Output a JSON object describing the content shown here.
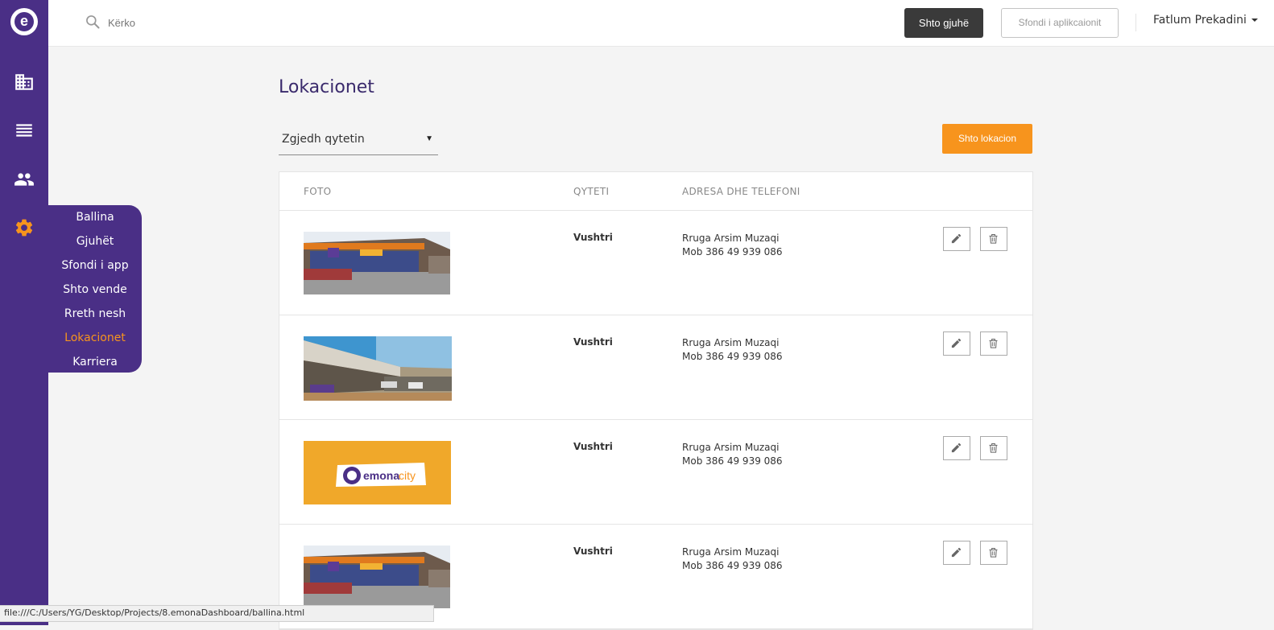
{
  "brand": {
    "logo_letter": "e"
  },
  "colors": {
    "primary": "#4a2f86",
    "accent": "#f7941d",
    "dark_button": "#3a3a3a"
  },
  "sidebar": {
    "icons": [
      "building-icon",
      "list-icon",
      "people-icon",
      "gear-icon"
    ],
    "active_icon": "gear-icon"
  },
  "menu": {
    "items": [
      {
        "label": "Ballina"
      },
      {
        "label": "Gjuhët"
      },
      {
        "label": "Sfondi i app"
      },
      {
        "label": "Shto vende"
      },
      {
        "label": "Rreth nesh"
      },
      {
        "label": "Lokacionet"
      },
      {
        "label": "Karriera"
      }
    ],
    "active": "Lokacionet"
  },
  "topbar": {
    "search_placeholder": "Kërko",
    "add_language": "Shto gjuhë",
    "app_background": "Sfondi i aplikcaionit",
    "user_name": "Fatlum Prekadini"
  },
  "page": {
    "title": "Lokacionet",
    "city_select": "Zgjedh qytetin",
    "add_location": "Shto lokacion"
  },
  "table": {
    "columns": [
      "FOTO",
      "QYTETI",
      "ADRESA DHE TELEFONI"
    ],
    "rows": [
      {
        "photo": "store-front-photo",
        "city": "Vushtri",
        "address": "Rruga Arsim Muzaqi",
        "phone": "Mob 386 49 939 086"
      },
      {
        "photo": "store-canopy-photo",
        "city": "Vushtri",
        "address": "Rruga Arsim Muzaqi",
        "phone": "Mob 386 49 939 086"
      },
      {
        "photo": "emona-city-logo",
        "city": "Vushtri",
        "address": "Rruga Arsim Muzaqi",
        "phone": "Mob 386 49 939 086",
        "logo_text_1": "emona",
        "logo_text_2": "city"
      },
      {
        "photo": "store-front-photo",
        "city": "Vushtri",
        "address": "Rruga Arsim Muzaqi",
        "phone": "Mob 386 49 939 086"
      }
    ]
  },
  "statusbar": {
    "url": "file:///C:/Users/YG/Desktop/Projects/8.emonaDashboard/ballina.html"
  }
}
